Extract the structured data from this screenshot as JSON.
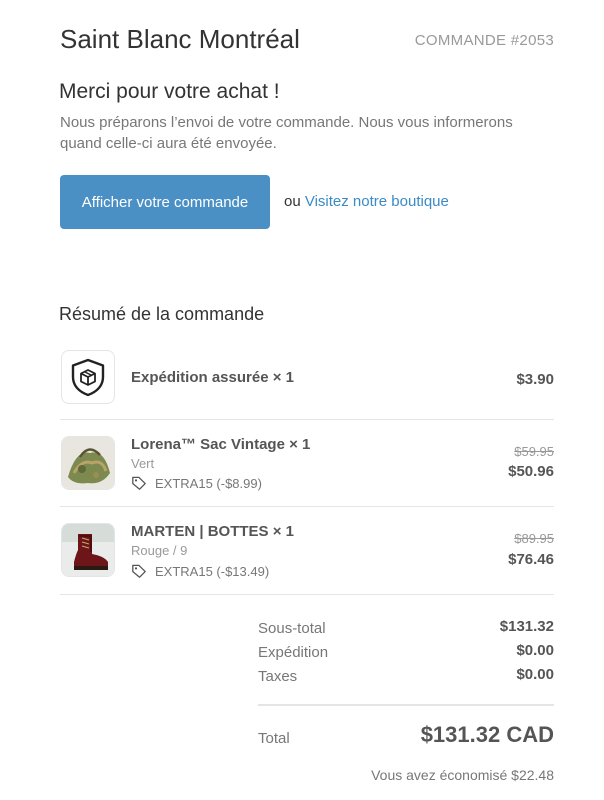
{
  "header": {
    "shop_name": "Saint Blanc Montréal",
    "order_number": "COMMANDE #2053"
  },
  "message": {
    "title": "Merci pour votre achat !",
    "body": "Nous préparons l’envoi de votre commande. Nous vous informerons quand celle-ci aura été envoyée."
  },
  "actions": {
    "view_order": "Afficher votre commande",
    "or_text": "ou",
    "visit_shop": "Visitez notre boutique"
  },
  "summary": {
    "title": "Résumé de la commande",
    "items": [
      {
        "title": "Expédition assurée × 1",
        "icon": "shield-package-icon",
        "price": "$3.90"
      },
      {
        "title": "Lorena™ Sac Vintage × 1",
        "variant": "Vert",
        "discount": "EXTRA15 (-$8.99)",
        "original_price": "$59.95",
        "price": "$50.96"
      },
      {
        "title": "MARTEN | BOTTES × 1",
        "variant": "Rouge / 9",
        "discount": "EXTRA15 (-$13.49)",
        "original_price": "$89.95",
        "price": "$76.46"
      }
    ]
  },
  "totals": {
    "subtotal_label": "Sous-total",
    "subtotal": "$131.32",
    "shipping_label": "Expédition",
    "shipping": "$0.00",
    "taxes_label": "Taxes",
    "taxes": "$0.00",
    "total_label": "Total",
    "total": "$131.32 CAD",
    "savings": "Vous avez économisé $22.48"
  },
  "colors": {
    "button": "#4a90c5",
    "link": "#3a8bc6"
  }
}
